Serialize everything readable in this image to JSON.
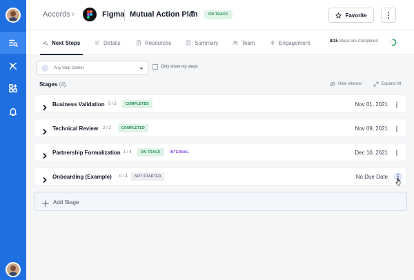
{
  "header": {
    "breadcrumb": "Accords",
    "account_name": "Figma",
    "plan_title": "Mutual Action Plan",
    "status": "ON TRACK",
    "favorite_label": "Favorite"
  },
  "tabs": [
    {
      "label": "Next Steps",
      "icon": "checklist-icon",
      "active": true
    },
    {
      "label": "Details",
      "icon": "details-icon",
      "active": false
    },
    {
      "label": "Resources",
      "icon": "document-icon",
      "active": false
    },
    {
      "label": "Summary",
      "icon": "summary-icon",
      "active": false
    },
    {
      "label": "Team",
      "icon": "team-icon",
      "active": false
    },
    {
      "label": "Engagement",
      "icon": "lightning-icon",
      "active": false
    }
  ],
  "progress": {
    "completed": "8/15",
    "label": "Steps are Completed",
    "fraction": 0.533
  },
  "filters": {
    "owner_placeholder": "Any Step Owner",
    "only_mine_label": "Only show my steps"
  },
  "stages_header": {
    "title": "Stages",
    "count": "(4)",
    "hide_internal": "Hide Internal",
    "expand_all": "Expand All"
  },
  "stages": [
    {
      "name": "Business Validation",
      "count": "5 / 5",
      "status": "COMPLETED",
      "internal": "",
      "date": "Nov 01, 2021"
    },
    {
      "name": "Technical Review",
      "count": "2 / 2",
      "status": "COMPLETED",
      "internal": "",
      "date": "Nov 09, 2021"
    },
    {
      "name": "Partnership Formalization",
      "count": "1 / 4",
      "status": "ON TRACK",
      "internal": "INTERNAL",
      "date": "Dec 10, 2021"
    },
    {
      "name": "Onboarding (Example)",
      "count": "0 / 4",
      "status": "NOT STARTED",
      "internal": "",
      "date": "No Due Date"
    }
  ],
  "add_stage_label": "Add Stage",
  "colors": {
    "rail": "#1f6fe0",
    "rail_active": "#3b86ef",
    "status_green_bg": "#dff4e7",
    "status_green_text": "#1b8a4b",
    "internal_purple": "#7c3aed"
  },
  "sidebar": {
    "icons": [
      "search-list-icon",
      "flow-icon",
      "grid-add-icon",
      "bell-icon"
    ]
  }
}
